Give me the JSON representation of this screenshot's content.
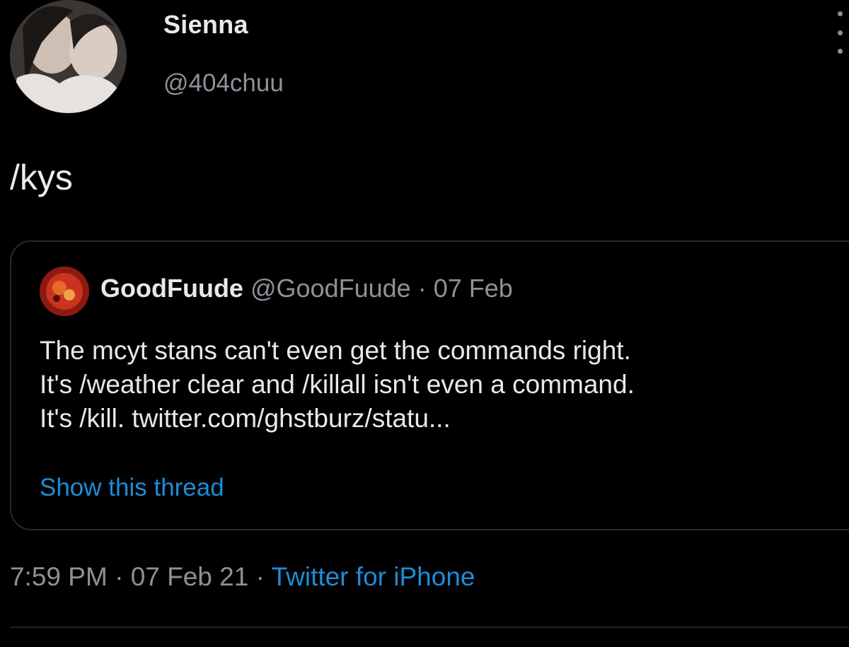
{
  "tweet": {
    "author": {
      "display_name": "Sienna",
      "handle": "@404chuu"
    },
    "text": "/kys",
    "quote": {
      "author_name": "GoodFuude",
      "author_handle": "@GoodFuude",
      "separator": "·",
      "date": "07 Feb",
      "lines": [
        "The mcyt stans can't even get the commands right.",
        "It's /weather clear and /killall isn't even a command.",
        "It's /kill. twitter.com/ghstburz/statu..."
      ],
      "show_thread_label": "Show this thread"
    },
    "meta": {
      "time": "7:59 PM",
      "separator": "·",
      "date": "07 Feb 21",
      "source": "Twitter for iPhone"
    }
  },
  "colors": {
    "background": "#000000",
    "text_primary": "#e7e9ea",
    "text_secondary": "#8b9299",
    "link": "#1d8cd8",
    "border": "#262a2e"
  },
  "icons": {
    "more": "more-vertical-icon"
  }
}
